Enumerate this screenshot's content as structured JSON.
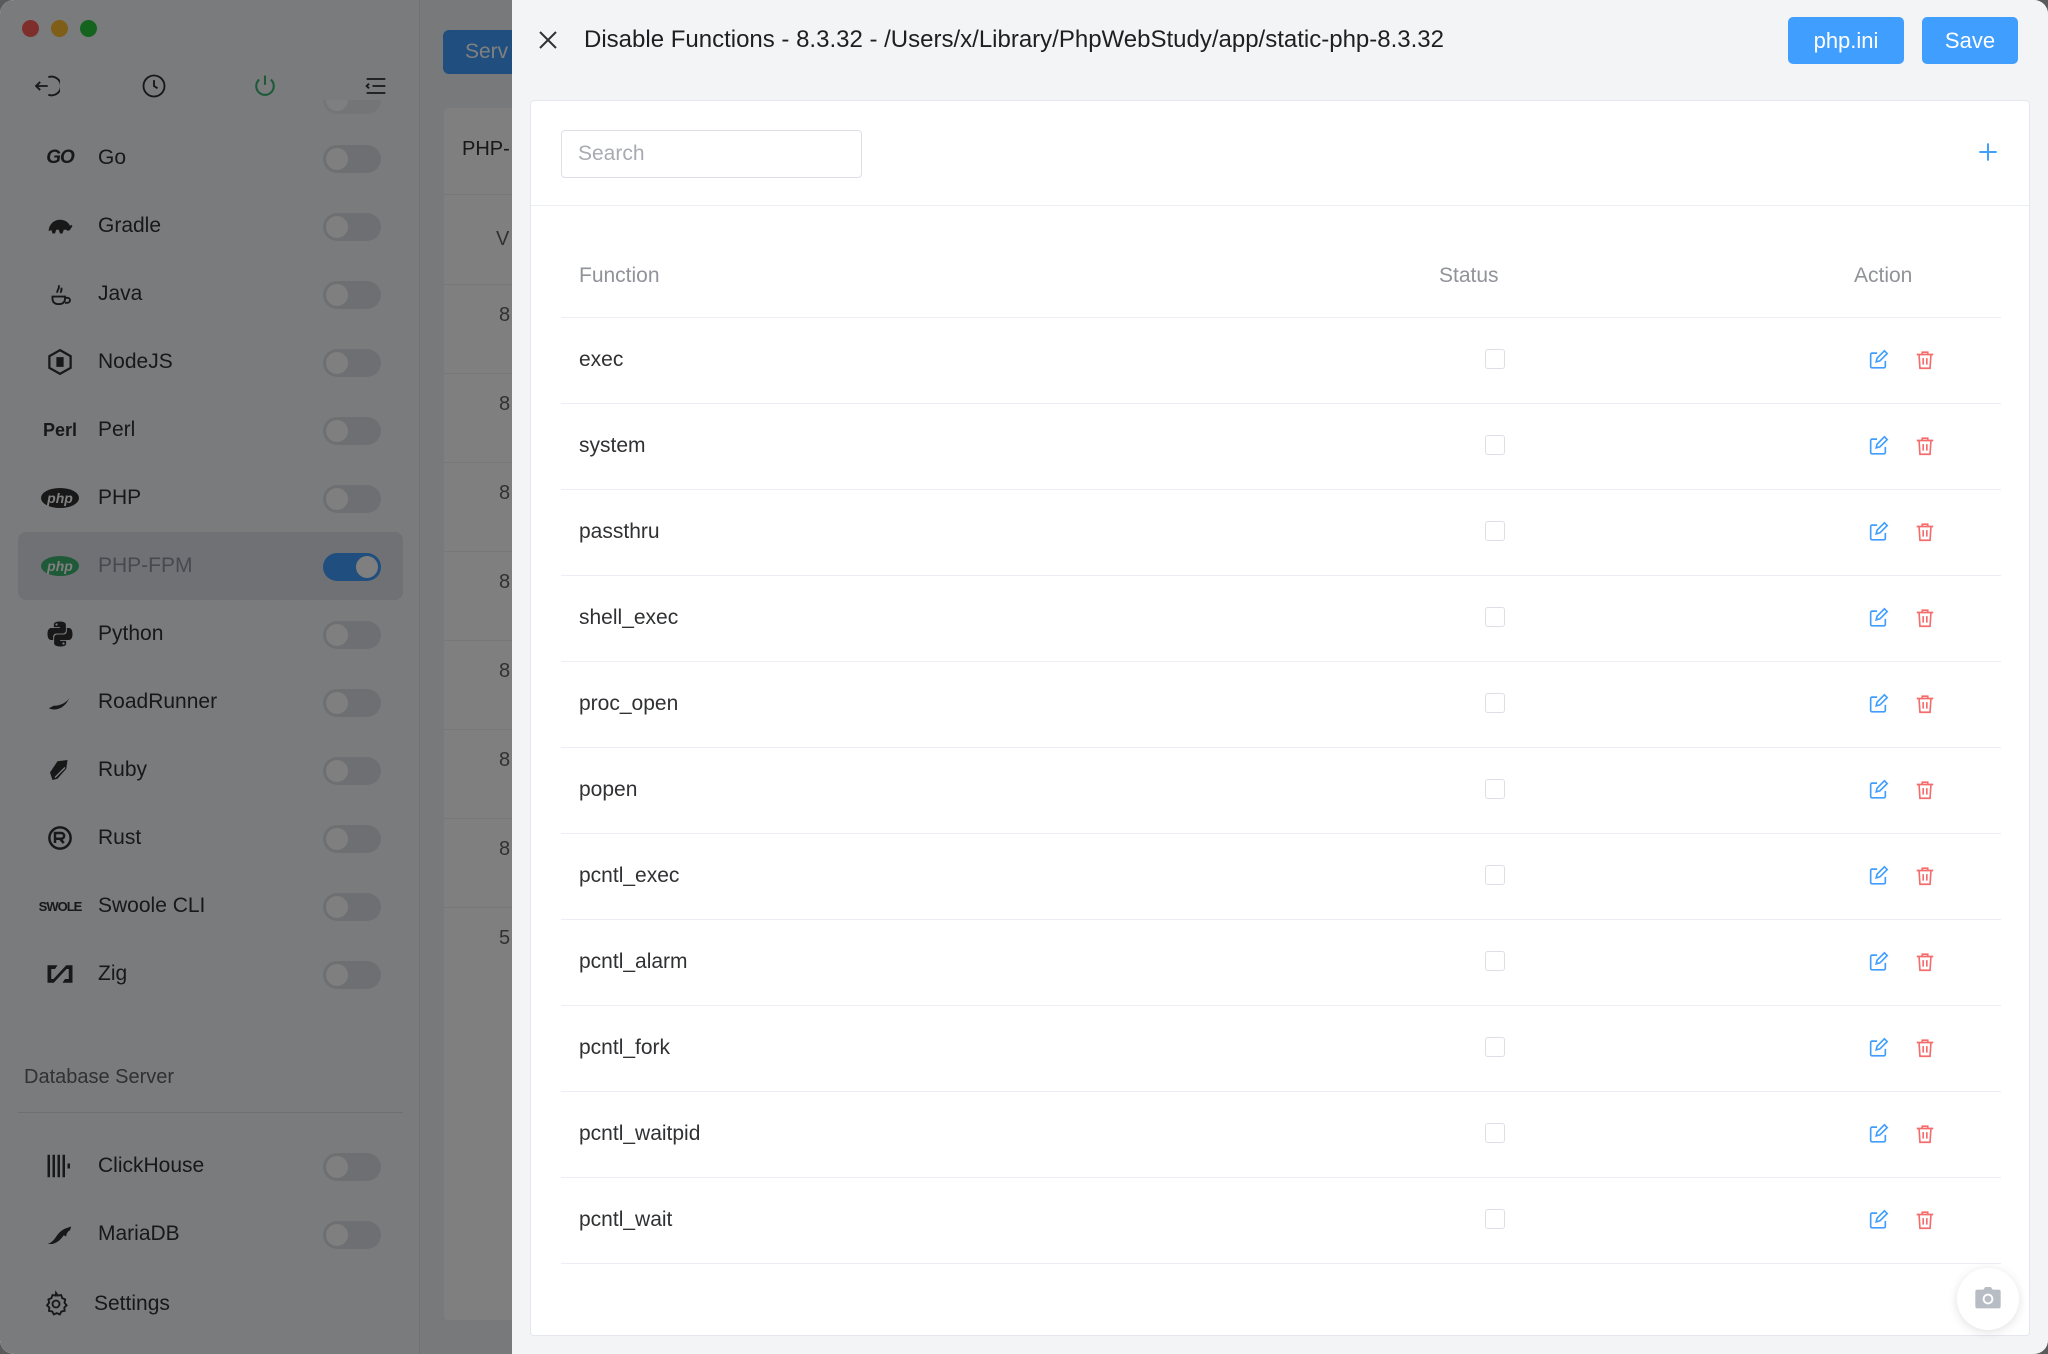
{
  "sidebar": {
    "items": [
      {
        "label": "Go",
        "icon": "go-logo-icon",
        "badge": "GO",
        "on": false
      },
      {
        "label": "Gradle",
        "icon": "gradle-elephant-icon",
        "badge": "",
        "on": false
      },
      {
        "label": "Java",
        "icon": "java-cup-icon",
        "badge": "",
        "on": false
      },
      {
        "label": "NodeJS",
        "icon": "nodejs-hexagon-icon",
        "badge": "",
        "on": false
      },
      {
        "label": "Perl",
        "icon": "perl-logo-icon",
        "badge": "Perl",
        "on": false
      },
      {
        "label": "PHP",
        "icon": "php-logo-icon",
        "badge": "php",
        "on": false
      },
      {
        "label": "PHP-FPM",
        "icon": "php-fpm-logo-icon",
        "badge": "php",
        "on": true
      },
      {
        "label": "Python",
        "icon": "python-logo-icon",
        "badge": "",
        "on": false
      },
      {
        "label": "RoadRunner",
        "icon": "roadrunner-logo-icon",
        "badge": "",
        "on": false
      },
      {
        "label": "Ruby",
        "icon": "ruby-logo-icon",
        "badge": "",
        "on": false
      },
      {
        "label": "Rust",
        "icon": "rust-logo-icon",
        "badge": "",
        "on": false
      },
      {
        "label": "Swoole CLI",
        "icon": "swoole-logo-icon",
        "badge": "SWOLE",
        "on": false
      },
      {
        "label": "Zig",
        "icon": "zig-logo-icon",
        "badge": "",
        "on": false
      }
    ],
    "section_title": "Database Server",
    "db_items": [
      {
        "label": "ClickHouse",
        "icon": "clickhouse-bars-icon",
        "on": false
      },
      {
        "label": "MariaDB",
        "icon": "mariadb-seal-icon",
        "on": false
      }
    ],
    "settings_label": "Settings"
  },
  "main": {
    "serv_label": "Serv",
    "card_header": "PHP-",
    "col_header": "V",
    "rows": [
      "8",
      "8",
      "8",
      "8",
      "8",
      "8",
      "8",
      "5"
    ]
  },
  "drawer": {
    "title": "Disable Functions - 8.3.32 - /Users/x/Library/PhpWebStudy/app/static-php-8.3.32",
    "phpini_label": "php.ini",
    "save_label": "Save",
    "search_placeholder": "Search",
    "columns": {
      "function": "Function",
      "status": "Status",
      "action": "Action"
    },
    "functions": [
      "exec",
      "system",
      "passthru",
      "shell_exec",
      "proc_open",
      "popen",
      "pcntl_exec",
      "pcntl_alarm",
      "pcntl_fork",
      "pcntl_waitpid",
      "pcntl_wait"
    ]
  },
  "colors": {
    "primary": "#409eff",
    "danger": "#f56c6c",
    "toggle_on": "#409eff",
    "php_green": "#3cb371"
  }
}
